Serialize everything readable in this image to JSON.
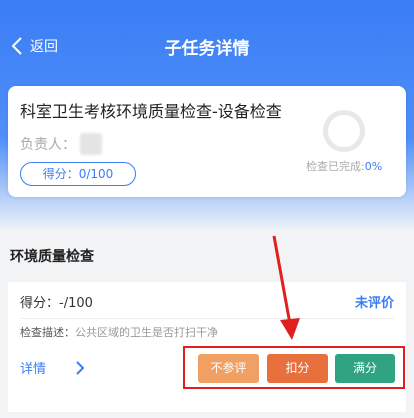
{
  "nav": {
    "back_label": "返回",
    "title": "子任务详情"
  },
  "task": {
    "title": "科室卫生考核环境质量检查-设备检查",
    "owner_label": "负责人：",
    "score_label": "得分：0/100",
    "progress_label": "检查已完成:",
    "progress_value": "0%"
  },
  "section": {
    "title": "环境质量检查"
  },
  "item": {
    "score": "得分：-/100",
    "status": "未评价",
    "desc_label": "检查描述：",
    "desc_value": "公共区域的卫生是否打扫干净",
    "detail_label": "详情"
  },
  "buttons": {
    "skip": "不参评",
    "deduct": "扣分",
    "full": "满分"
  },
  "colors": {
    "primary": "#3b7df6",
    "skip": "#f0a062",
    "deduct": "#e8703c",
    "full": "#30a383",
    "highlight": "#e02020"
  }
}
